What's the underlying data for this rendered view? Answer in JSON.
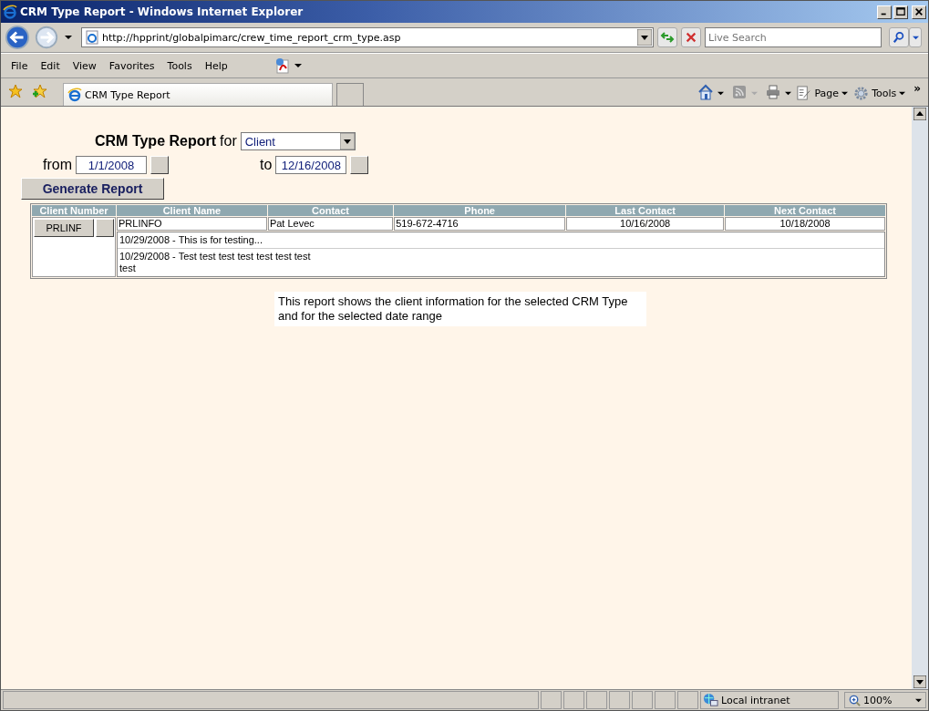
{
  "window": {
    "title": "CRM Type Report - Windows Internet Explorer"
  },
  "address_bar": {
    "url": "http://hpprint/globalpimarc/crew_time_report_crm_type.asp"
  },
  "search": {
    "placeholder": "Live Search"
  },
  "menu": [
    "File",
    "Edit",
    "View",
    "Favorites",
    "Tools",
    "Help"
  ],
  "tabs": [
    {
      "label": "CRM Type Report",
      "selected": true
    }
  ],
  "command_bar": {
    "page": "Page",
    "tools": "Tools",
    "overflow": "»"
  },
  "page": {
    "heading": "CRM Type Report",
    "for_label": "for",
    "crm_type": "Client",
    "from_label": "from",
    "from_date": "1/1/2008",
    "to_label": "to",
    "to_date": "12/16/2008",
    "generate_button": "Generate Report",
    "table": {
      "columns": [
        "Client Number",
        "Client Name",
        "Contact",
        "Phone",
        "Last Contact",
        "Next Contact"
      ],
      "rows": [
        {
          "client_number": "PRLINF",
          "client_name": "PRLINFO",
          "contact": "Pat Levec",
          "phone": "519-672-4716",
          "last_contact": "10/16/2008",
          "next_contact": "10/18/2008",
          "notes": [
            "10/29/2008 - This is for testing...",
            "10/29/2008 - Test test test test test test test\ntest"
          ]
        }
      ]
    },
    "note": "This report shows the client information for the selected CRM Type and for the selected date range"
  },
  "status_bar": {
    "zone": "Local intranet",
    "zoom": "100%"
  }
}
